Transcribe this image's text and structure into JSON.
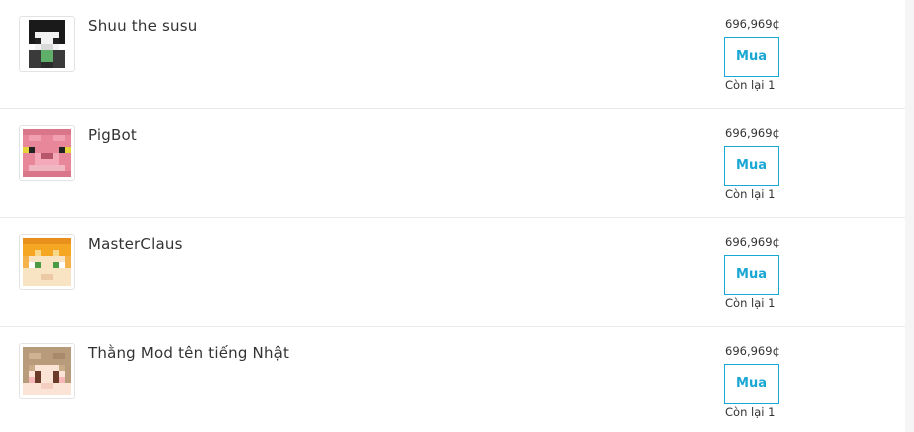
{
  "items": [
    {
      "name": "Shuu the susu",
      "price": "696,969¢",
      "buy_label": "Mua",
      "stock": "Còn lại 1",
      "avatar_icon": "skin-head-shuu-icon"
    },
    {
      "name": "PigBot",
      "price": "696,969¢",
      "buy_label": "Mua",
      "stock": "Còn lại 1",
      "avatar_icon": "skin-head-pig-icon"
    },
    {
      "name": "MasterClaus",
      "price": "696,969¢",
      "buy_label": "Mua",
      "stock": "Còn lại 1",
      "avatar_icon": "skin-head-orange-hair-icon"
    },
    {
      "name": "Thằng Mod tên tiếng Nhật",
      "price": "696,969¢",
      "buy_label": "Mua",
      "stock": "Còn lại 1",
      "avatar_icon": "skin-head-brown-hair-icon"
    }
  ],
  "colors": {
    "accent": "#1aa7d3",
    "text": "#333333",
    "divider": "#e9e9e9"
  }
}
